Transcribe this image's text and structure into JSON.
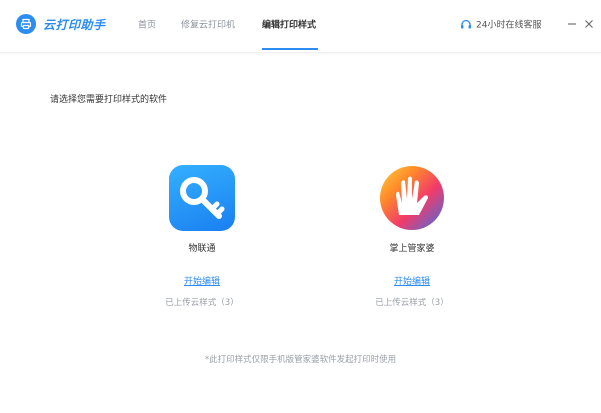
{
  "header": {
    "logo_text": "云打印助手",
    "tabs": [
      {
        "label": "首页"
      },
      {
        "label": "修复云打印机"
      },
      {
        "label": "编辑打印样式"
      }
    ],
    "active_tab": 2,
    "service_label": "24小时在线客服"
  },
  "colors": {
    "brand": "#2b8cf2",
    "muted_text": "#9aa0a8"
  },
  "main": {
    "prompt": "请选择您需要打印样式的软件",
    "apps": [
      {
        "name": "物联通",
        "action": "开始编辑",
        "status": "已上传云样式（3）",
        "icon": "blue-key-icon"
      },
      {
        "name": "掌上管家婆",
        "action": "开始编辑",
        "status": "已上传云样式（3）",
        "icon": "rainbow-hand-icon"
      }
    ],
    "footnote": "*此打印样式仅限手机版管家婆软件发起打印时使用"
  }
}
